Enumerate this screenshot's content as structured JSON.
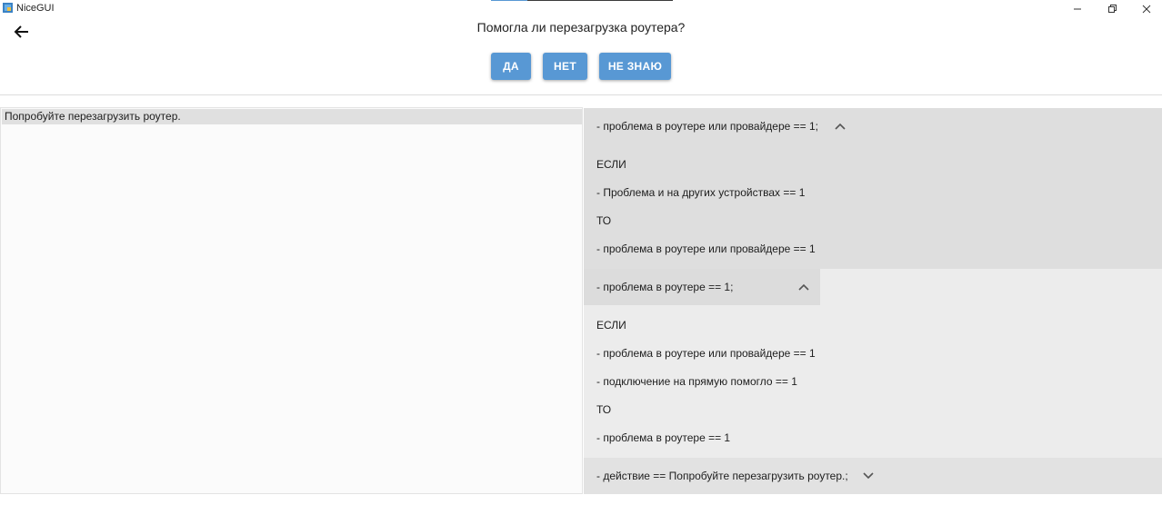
{
  "window": {
    "title": "NiceGUI",
    "progress": 0.2,
    "minimize_icon": "minimize-icon",
    "maximize_icon": "restore-icon",
    "close_icon": "close-icon"
  },
  "header": {
    "back_icon": "arrow-left-icon",
    "question": "Помогла ли перезагрузка роутера?",
    "buttons": {
      "yes": "ДА",
      "no": "НЕТ",
      "dont_know": "НЕ ЗНАЮ"
    },
    "button_color": "#5898d4"
  },
  "left": {
    "action_text": "Попробуйте перезагрузить роутер."
  },
  "rules": [
    {
      "title": "- проблема в роутере или провайдере == 1;",
      "expanded": true,
      "lines": [
        "ЕСЛИ",
        "- Проблема и на других устройствах == 1",
        "ТО",
        "- проблема в роутере или провайдере == 1"
      ]
    },
    {
      "title": "- проблема в роутере == 1;",
      "expanded": true,
      "lines": [
        "ЕСЛИ",
        "- проблема в роутере или провайдере == 1",
        "- подключение на прямую помогло == 1",
        "ТО",
        "- проблема в роутере == 1"
      ]
    },
    {
      "title": "- действие == Попробуйте перезагрузить роутер.;",
      "expanded": false,
      "lines": []
    }
  ]
}
